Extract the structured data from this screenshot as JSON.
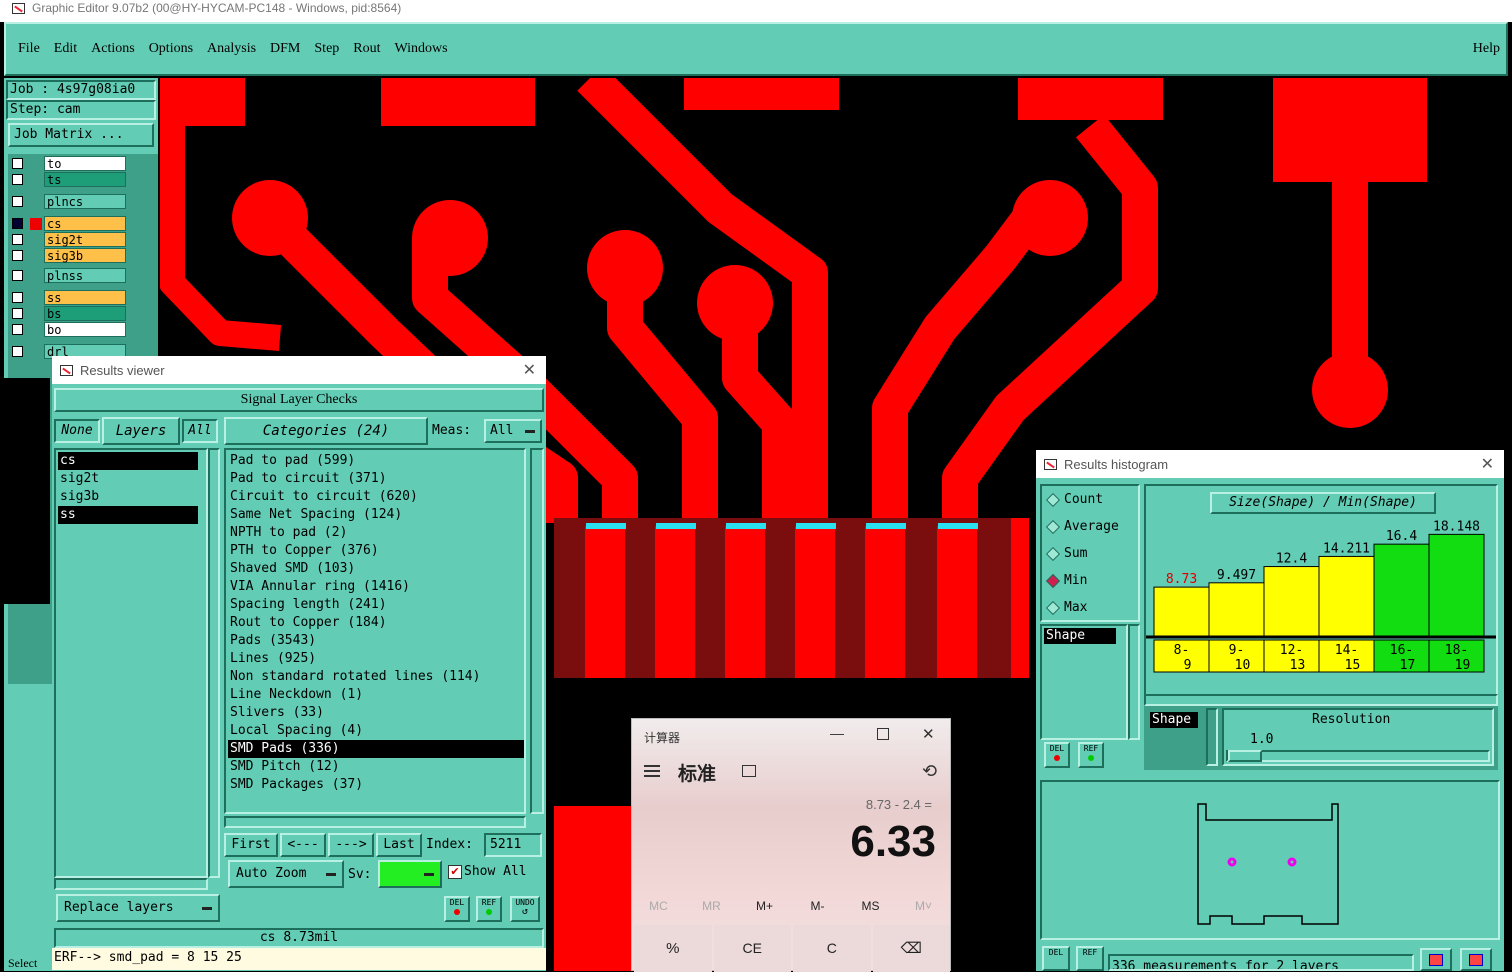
{
  "window": {
    "title": "Graphic Editor 9.07b2 (00@HY-HYCAM-PC148 - Windows, pid:8564)"
  },
  "menu": {
    "items": [
      "File",
      "Edit",
      "Actions",
      "Options",
      "Analysis",
      "DFM",
      "Step",
      "Rout",
      "Windows"
    ],
    "help": "Help"
  },
  "job": {
    "job_label": "Job : 4s97g08ia0",
    "step_label": "Step: cam",
    "matrix_button": "Job Matrix ..."
  },
  "layers": [
    {
      "name": "to",
      "color": "#ffffff"
    },
    {
      "name": "ts",
      "color": "#1d9e78"
    },
    {
      "name": "plncs",
      "color": "#62ccb4"
    },
    {
      "name": "cs",
      "color": "#ffc04a"
    },
    {
      "name": "sig2t",
      "color": "#ffc04a"
    },
    {
      "name": "sig3b",
      "color": "#ffc04a"
    },
    {
      "name": "plnss",
      "color": "#62ccb4"
    },
    {
      "name": "ss",
      "color": "#ffc04a"
    },
    {
      "name": "bs",
      "color": "#1d9e78"
    },
    {
      "name": "bo",
      "color": "#ffffff"
    },
    {
      "name": "drl",
      "color": "#62ccb4"
    }
  ],
  "results_viewer": {
    "title": "Results viewer",
    "header": "Signal Layer Checks",
    "none_btn": "None",
    "layers_btn": "Layers",
    "all_btn": "All",
    "categories_btn": "Categories (24)",
    "meas_label": "Meas:",
    "meas_value": "All",
    "layer_list": [
      "cs",
      "sig2t",
      "sig3b",
      "ss"
    ],
    "categories": [
      "Pad to pad (599)",
      "Pad to circuit (371)",
      "Circuit to circuit (620)",
      "Same Net Spacing (124)",
      "NPTH to pad (2)",
      "PTH to Copper (376)",
      "Shaved SMD (103)",
      "VIA Annular ring (1416)",
      "Spacing length (241)",
      "Rout to Copper (184)",
      "Pads (3543)",
      "Lines (925)",
      "Non standard rotated lines (114)",
      "Line Neckdown (1)",
      "Slivers (33)",
      "Local Spacing (4)",
      "SMD Pads (336)",
      "SMD Pitch (12)",
      "SMD Packages (37)"
    ],
    "selected_category": "SMD Pads (336)",
    "first_btn": "First",
    "prev_btn": "<---",
    "next_btn": "--->",
    "last_btn": "Last",
    "index_label": "Index:",
    "index_value": "5211",
    "auto_zoom_btn": "Auto Zoom",
    "sv_label": "Sv:",
    "show_all_label": "Show All",
    "replace_layers_btn": "Replace layers",
    "del_btn": "DEL",
    "ref_btn": "REF",
    "undo_btn": "UNDO",
    "status": "cs 8.73mil",
    "erf_line": "ERF--> smd_pad = 8 15 25"
  },
  "histogram": {
    "title": "Results histogram",
    "radio": [
      "Count",
      "Average",
      "Sum",
      "Min",
      "Max"
    ],
    "selected_radio": "Min",
    "chart_title": "Size(Shape) / Min(Shape)",
    "shape_label": "Shape",
    "resolution_label": "Resolution",
    "resolution_value": "1.0",
    "measurements": "336 measurements for 2 layers",
    "del_btn": "DEL",
    "ref_btn": "REF"
  },
  "chart_data": {
    "type": "bar",
    "title": "Size(Shape) / Min(Shape)",
    "categories": [
      "8-9",
      "9-10",
      "12-13",
      "14-15",
      "16-17",
      "18-19"
    ],
    "values": [
      8.73,
      9.497,
      12.4,
      14.211,
      16.4,
      18.148
    ],
    "value_labels": [
      "8.73",
      "9.497",
      "12.4",
      "14.211",
      "16.4",
      "18.148"
    ],
    "cat_top": [
      "8-",
      "9-",
      "12-",
      "14-",
      "16-",
      "18-"
    ],
    "cat_bottom": [
      "9",
      "10",
      "13",
      "15",
      "17",
      "19"
    ],
    "colors": [
      "#ffff00",
      "#ffff00",
      "#ffff00",
      "#ffff00",
      "#11dd11",
      "#11dd11"
    ],
    "highlight_label_color": "#dd0000"
  },
  "calculator": {
    "title": "计算器",
    "mode": "标准",
    "expression": "8.73 - 2.4 =",
    "result": "6.33",
    "memory": [
      "MC",
      "MR",
      "M+",
      "M-",
      "MS",
      "M˅"
    ],
    "keys": [
      "%",
      "CE",
      "C",
      "⌫"
    ]
  },
  "bottom_left": {
    "select_label": "Select"
  }
}
